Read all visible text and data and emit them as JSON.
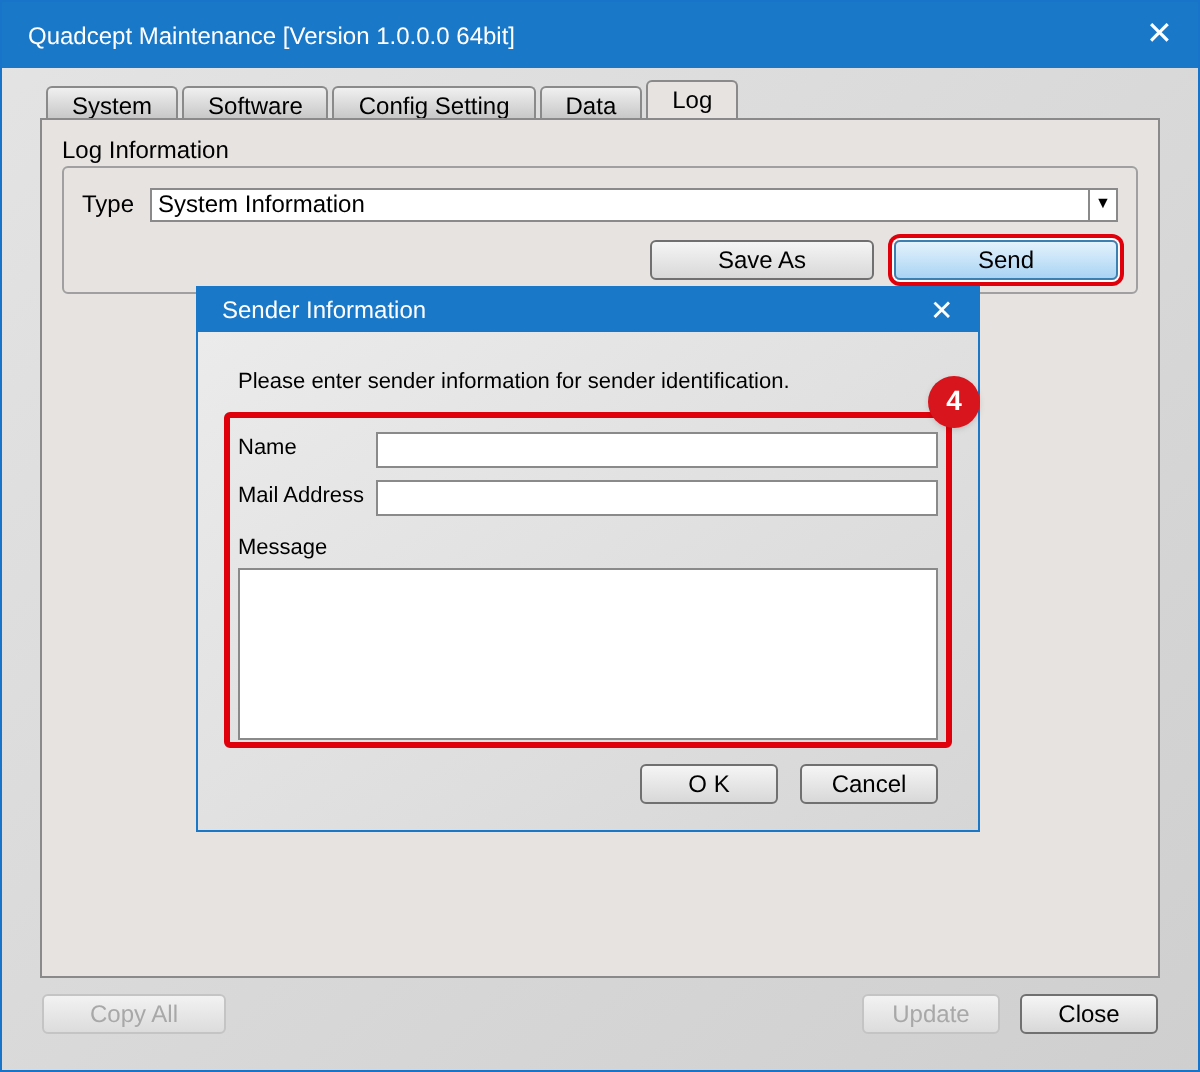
{
  "window": {
    "title": "Quadcept Maintenance [Version 1.0.0.0 64bit]",
    "close": "✕"
  },
  "tabs": [
    {
      "label": "System",
      "selected": false
    },
    {
      "label": "Software",
      "selected": false
    },
    {
      "label": "Config Setting",
      "selected": false
    },
    {
      "label": "Data",
      "selected": false
    },
    {
      "label": "Log",
      "selected": true
    }
  ],
  "log_information": {
    "title": "Log Information",
    "type_label": "Type",
    "type_value": "System Information",
    "dropdown_arrow": "▼",
    "buttons": [
      {
        "label": "Save As",
        "highlighted": false
      },
      {
        "label": "Send",
        "highlighted": true
      }
    ]
  },
  "dialog": {
    "title": "Sender Information",
    "close": "✕",
    "instruction": "Please enter sender information for sender identification.",
    "callout": "4",
    "fields": [
      {
        "label": "Name",
        "kind": "line"
      },
      {
        "label": "Mail Address",
        "kind": "line"
      },
      {
        "label": "Message",
        "kind": "area"
      }
    ],
    "buttons": [
      "O K",
      "Cancel"
    ]
  },
  "footer": {
    "left_buttons": [
      {
        "label": "Copy All",
        "disabled": true
      }
    ],
    "right_buttons": [
      {
        "label": "Update",
        "disabled": true
      },
      {
        "label": "Close",
        "disabled": false
      }
    ]
  }
}
